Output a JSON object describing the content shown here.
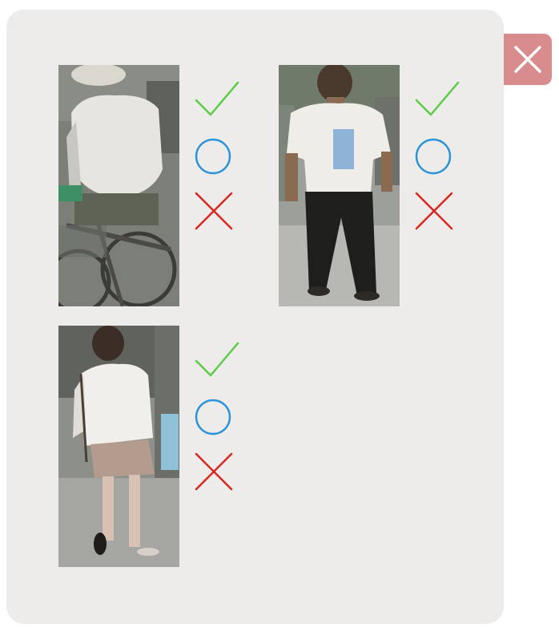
{
  "dialog": {
    "close_icon": "close-icon",
    "close_color": "#d98c8d"
  },
  "icons": {
    "accept": "check-icon",
    "neutral": "circle-icon",
    "reject": "x-icon"
  },
  "colors": {
    "accept": "#5ccb46",
    "neutral": "#2b93d8",
    "reject": "#d7281f",
    "panel": "#edeceb"
  },
  "cards": [
    {
      "id": 1,
      "subject": "man-on-bicycle-white-shirt"
    },
    {
      "id": 2,
      "subject": "man-white-tshirt-black-pants"
    },
    {
      "id": 3,
      "subject": "woman-white-top-walking"
    }
  ]
}
